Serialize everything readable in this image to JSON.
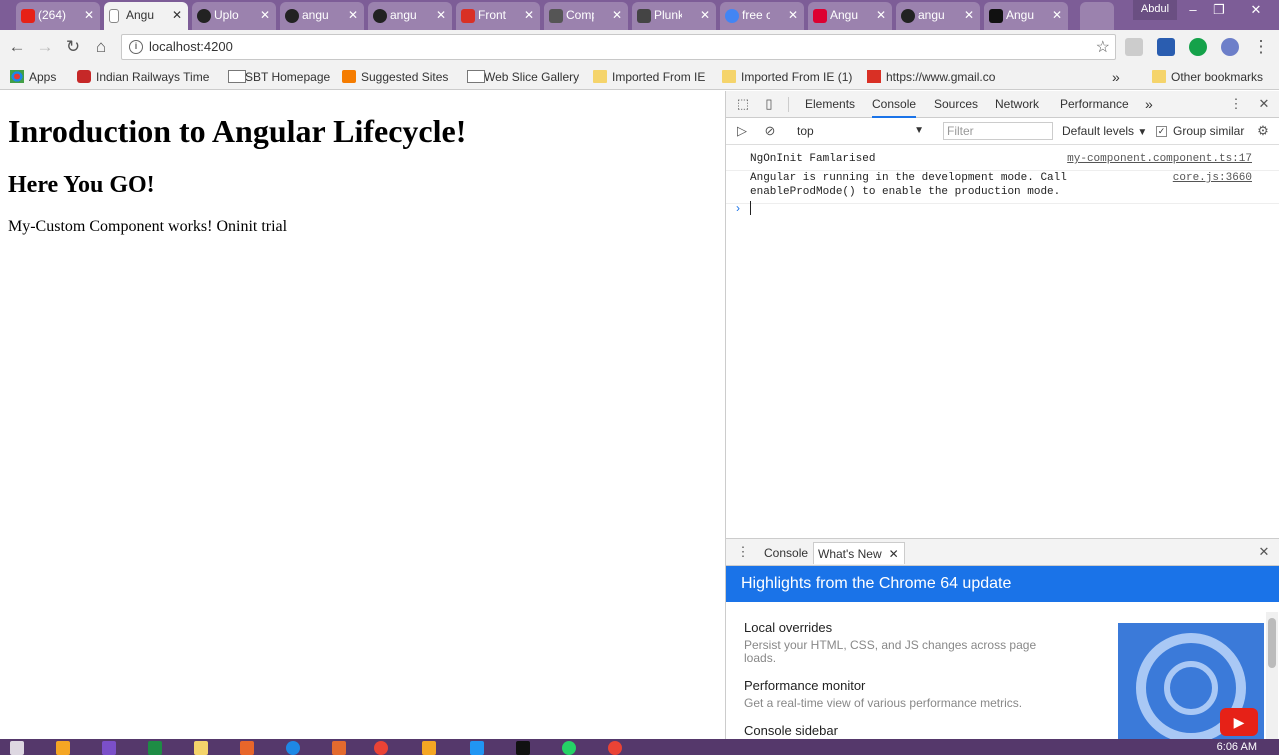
{
  "browser": {
    "tabs": [
      {
        "label": "(264)",
        "icon": "youtube-icon",
        "color": "#e62117"
      },
      {
        "label": "Angu",
        "icon": "page-icon",
        "color": "#888888"
      },
      {
        "label": "Uplo",
        "icon": "github-icon",
        "color": "#222222"
      },
      {
        "label": "angu",
        "icon": "github-icon",
        "color": "#222222"
      },
      {
        "label": "angu",
        "icon": "github-icon",
        "color": "#222222"
      },
      {
        "label": "Front",
        "icon": "gmail-icon",
        "color": "#d93025"
      },
      {
        "label": "Comp",
        "icon": "book-icon",
        "color": "#555555"
      },
      {
        "label": "Plunk",
        "icon": "plunker-icon",
        "color": "#444444"
      },
      {
        "label": "free c",
        "icon": "google-icon",
        "color": "#4285f4"
      },
      {
        "label": "Angu",
        "icon": "angular-icon",
        "color": "#dd0031"
      },
      {
        "label": "angu",
        "icon": "github-icon",
        "color": "#222222"
      },
      {
        "label": "Angu",
        "icon": "codepen-icon",
        "color": "#111111"
      }
    ],
    "user": "Abdul",
    "url": "localhost:4200",
    "bookmarks": [
      {
        "label": "Apps",
        "icon": "apps-icon"
      },
      {
        "label": "Indian Railways Time",
        "icon": "railways-icon"
      },
      {
        "label": "SBT Homepage",
        "icon": "page-icon"
      },
      {
        "label": "Suggested Sites",
        "icon": "suggested-icon"
      },
      {
        "label": "Web Slice Gallery",
        "icon": "page-icon"
      },
      {
        "label": "Imported From IE",
        "icon": "folder-icon"
      },
      {
        "label": "Imported From IE (1)",
        "icon": "folder-icon"
      },
      {
        "label": "https://www.gmail.co",
        "icon": "gmail-icon"
      }
    ],
    "other_bookmarks": "Other bookmarks"
  },
  "page": {
    "h1": "Inroduction to Angular Lifecycle!",
    "h2": "Here You GO!",
    "p": "My-Custom Component works! Oninit trial"
  },
  "devtools": {
    "tabs": [
      "Elements",
      "Console",
      "Sources",
      "Network",
      "Performance"
    ],
    "active_tab": "Console",
    "more": "»",
    "context": "top",
    "filter_placeholder": "Filter",
    "levels": "Default levels",
    "group_similar": "Group similar",
    "messages": [
      {
        "text": "NgOnInit Famlarised",
        "source": "my-component.component.ts:17"
      },
      {
        "text_line1": "Angular is running in the development mode. Call",
        "text_line2": "enableProdMode() to enable the production mode.",
        "source": "core.js:3660"
      }
    ],
    "drawer": {
      "tabs": [
        "Console",
        "What's New"
      ],
      "banner": "Highlights from the Chrome 64 update",
      "items": [
        {
          "title": "Local overrides",
          "desc": "Persist your HTML, CSS, and JS changes across page loads."
        },
        {
          "title": "Performance monitor",
          "desc": "Get a real-time view of various performance metrics."
        },
        {
          "title": "Console sidebar",
          "desc": ""
        }
      ]
    }
  },
  "taskbar": {
    "clock": "6:06 AM"
  }
}
